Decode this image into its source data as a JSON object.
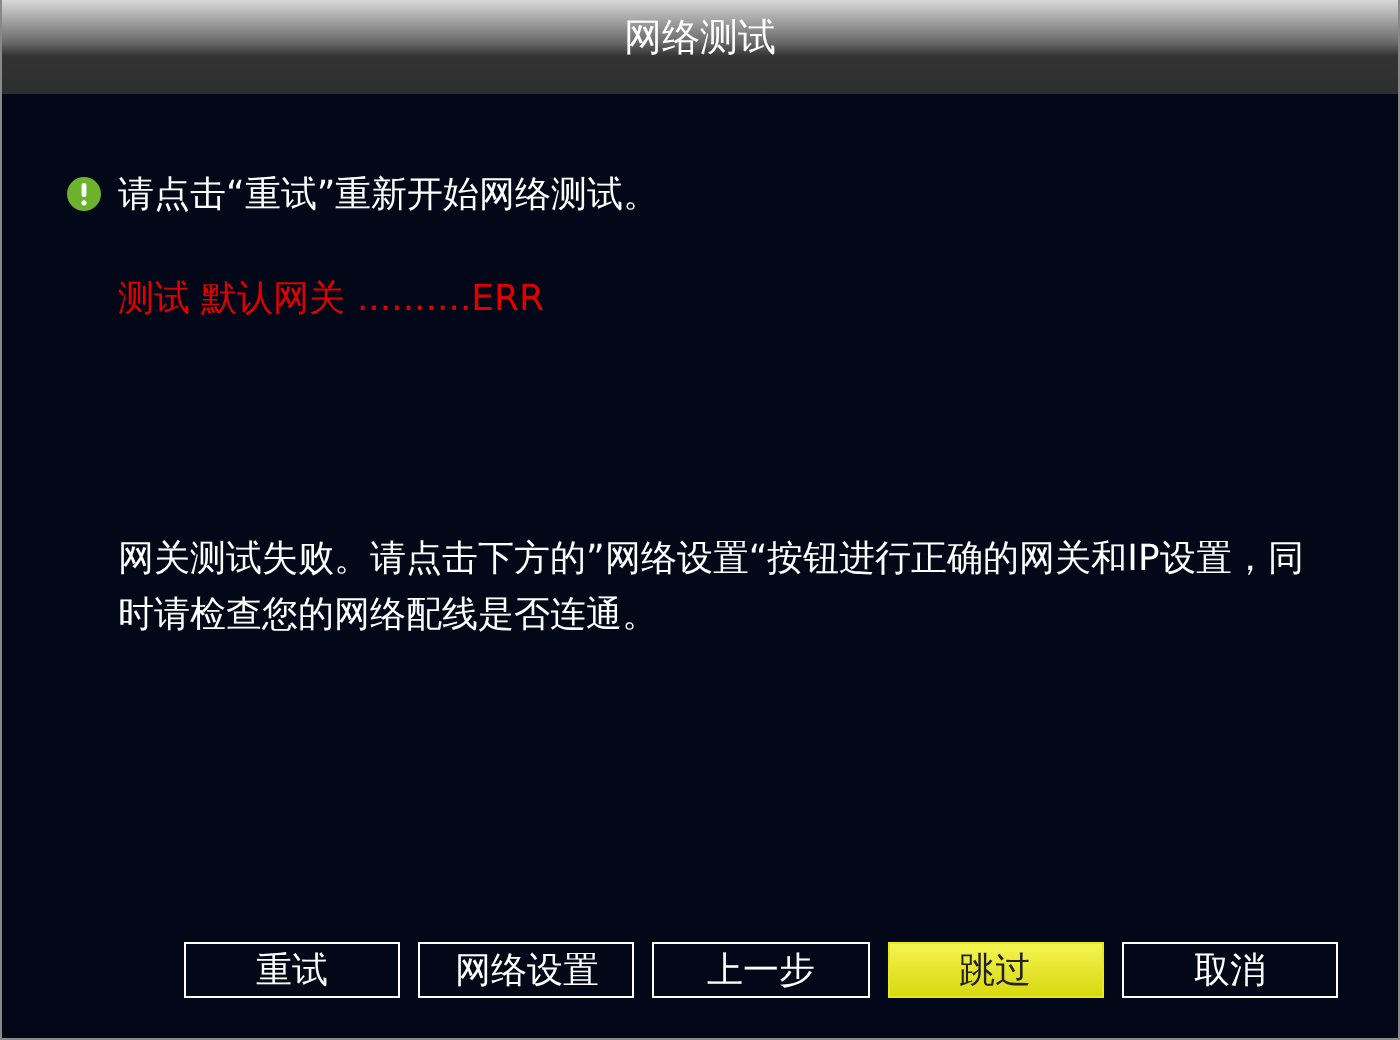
{
  "window": {
    "title": "网络测试"
  },
  "hint": "请点击“重试”重新开始网络测试。",
  "result": "测试 默认网关 ..........ERR",
  "message": "网关测试失败。请点击下方的”网络设置“按钮进行正确的网关和IP设置，同时请检查您的网络配线是否连通。",
  "buttons": [
    {
      "label": "重试",
      "selected": false
    },
    {
      "label": "网络设置",
      "selected": false
    },
    {
      "label": "上一步",
      "selected": false
    },
    {
      "label": "跳过",
      "selected": true
    },
    {
      "label": "取消",
      "selected": false
    }
  ]
}
